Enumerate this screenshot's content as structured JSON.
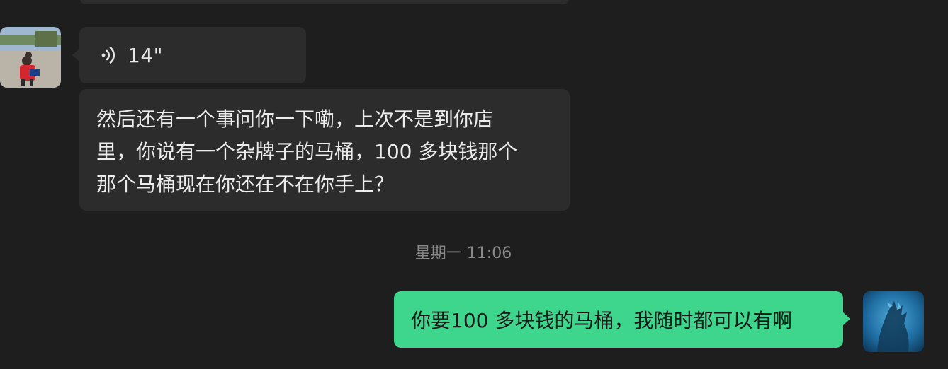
{
  "messages": {
    "voice": {
      "duration": "14\""
    },
    "incoming_text": {
      "line1": "然后还有一个事问你一下嘞，上次不是到你店",
      "line2": "里，你说有一个杂牌子的马桶，100 多块钱那个",
      "line3": "那个马桶现在你还在不在你手上？"
    },
    "timestamp": "星期一 11:06",
    "outgoing_text": "你要100 多块钱的马桶，我随时都可以有啊"
  },
  "colors": {
    "background": "#1e1e1e",
    "incoming_bubble": "#2c2c2c",
    "outgoing_bubble": "#3ed68c",
    "timestamp": "#8a8a8a"
  },
  "icons": {
    "voice": "voice-wave-icon"
  }
}
